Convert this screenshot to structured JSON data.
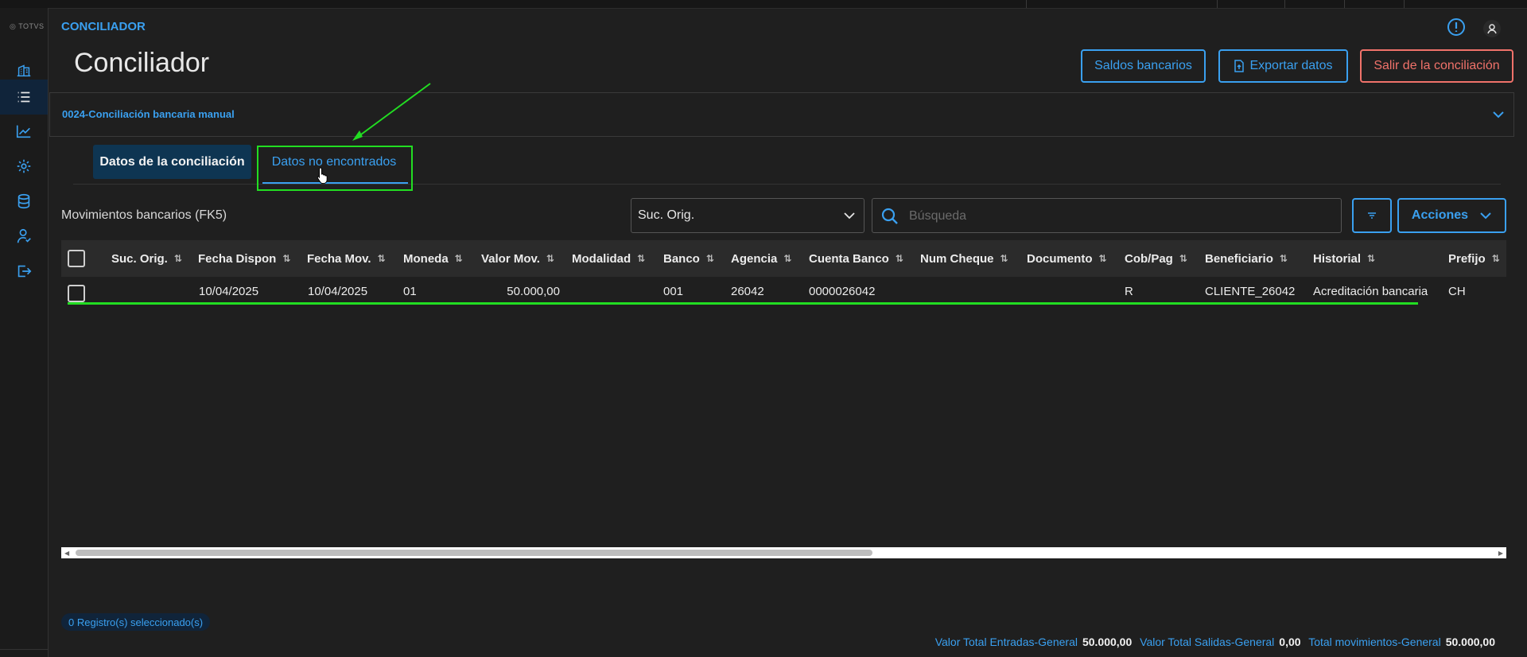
{
  "app": {
    "logo": "TOTVS",
    "name": "CONCILIADOR"
  },
  "page": {
    "title": "Conciliador"
  },
  "header_buttons": {
    "saldos": "Saldos bancarios",
    "exportar": "Exportar datos",
    "salir": "Salir de la conciliación"
  },
  "accordion": {
    "label": "0024-Conciliación bancaria manual"
  },
  "tabs": [
    {
      "label": "Datos de la conciliación",
      "active": false
    },
    {
      "label": "Datos no encontrados",
      "active": true
    }
  ],
  "table_section": {
    "title": "Movimientos bancarios (FK5)",
    "branch_select": "Suc. Orig.",
    "search_placeholder": "Búsqueda",
    "actions_label": "Acciones"
  },
  "table": {
    "columns": [
      "Suc. Orig.",
      "Fecha Dispon",
      "Fecha Mov.",
      "Moneda",
      "Valor Mov.",
      "Modalidad",
      "Banco",
      "Agencia",
      "Cuenta Banco",
      "Num Cheque",
      "Documento",
      "Cob/Pag",
      "Beneficiario",
      "Historial",
      "Prefijo"
    ],
    "rows": [
      {
        "suc_orig": "",
        "fecha_dispon": "10/04/2025",
        "fecha_mov": "10/04/2025",
        "moneda": "01",
        "valor_mov": "50.000,00",
        "modalidad": "",
        "banco": "001",
        "agencia": "26042",
        "cuenta_banco": "0000026042",
        "num_cheque": "",
        "documento": "",
        "cob_pag": "R",
        "beneficiario": "CLIENTE_26042",
        "historial": "Acreditación bancaria",
        "prefijo": "CH"
      }
    ]
  },
  "footer": {
    "selected": "0 Registro(s) seleccionado(s)",
    "totals": [
      {
        "label": "Valor Total Entradas-General",
        "value": "50.000,00"
      },
      {
        "label": "Valor Total Salidas-General",
        "value": "0,00"
      },
      {
        "label": "Total movimientos-General",
        "value": "50.000,00"
      }
    ]
  },
  "colors": {
    "accent": "#3aa0f0",
    "danger": "#f0726a",
    "annotation": "#22dd22",
    "background": "#1f1f1f"
  },
  "sidebar_icons": [
    "building-icon",
    "list-icon",
    "chart-icon",
    "gear-icon",
    "database-icon",
    "user-icon",
    "logout-icon"
  ]
}
